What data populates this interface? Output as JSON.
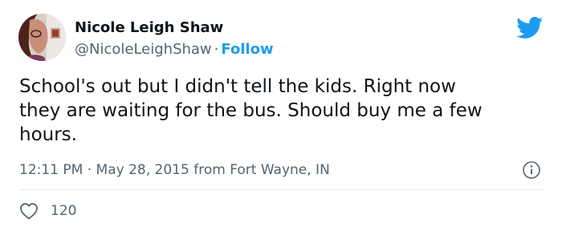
{
  "author": {
    "name": "Nicole Leigh Shaw",
    "handle": "@NicoleLeighShaw"
  },
  "separator": "·",
  "follow_label": "Follow",
  "text": "School's out but I didn't tell the kids. Right now\nthey are waiting for the bus. Should buy me a few\nhours.",
  "meta": {
    "time": "12:11 PM",
    "date": "May 28, 2015",
    "from_label": "from",
    "location": "Fort Wayne, IN"
  },
  "likes": "120",
  "icons": {
    "logo": "twitter-bird-icon",
    "info": "info-icon",
    "like": "heart-icon"
  },
  "colors": {
    "accent": "#1d9bf0",
    "text": "#0f1419",
    "muted": "#536471"
  }
}
